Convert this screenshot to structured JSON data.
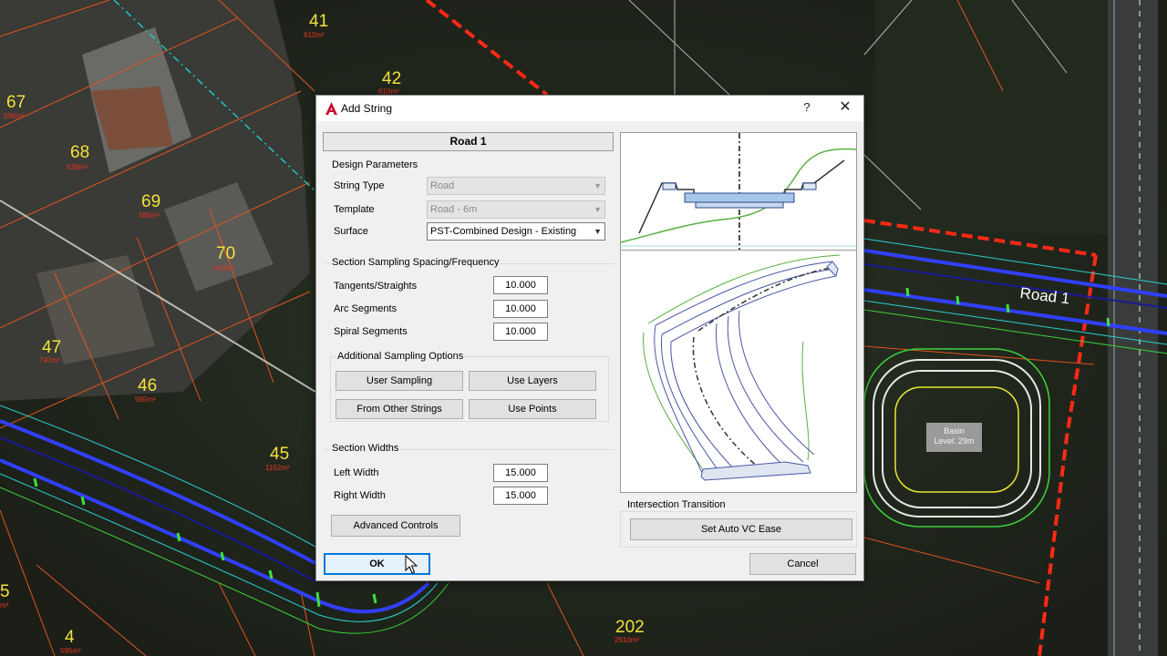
{
  "map": {
    "lots": [
      {
        "number": "41",
        "area": "610m²"
      },
      {
        "number": "42",
        "area": "610m²"
      },
      {
        "number": "67",
        "area": "596m²"
      },
      {
        "number": "68",
        "area": "638m²"
      },
      {
        "number": "69",
        "area": "585m²"
      },
      {
        "number": "70",
        "area": "643m²"
      },
      {
        "number": "47",
        "area": "740m²"
      },
      {
        "number": "46",
        "area": "565m²"
      },
      {
        "number": "45",
        "area": "1162m²"
      },
      {
        "number": "5",
        "area": "m²"
      },
      {
        "number": "4",
        "area": "595m²"
      },
      {
        "number": "202",
        "area": "2910m²"
      }
    ],
    "road_label": "Road 1",
    "basin_label_line1": "Basin",
    "basin_label_line2": "Level: 29m"
  },
  "dialog": {
    "title": "Add String",
    "help_glyph": "?",
    "close_glyph": "✕",
    "string_name": "Road 1",
    "design_parameters": {
      "heading": "Design Parameters",
      "string_type_label": "String Type",
      "string_type_value": "Road",
      "template_label": "Template",
      "template_value": "Road - 6m",
      "surface_label": "Surface",
      "surface_value": "PST-Combined Design - Existing"
    },
    "sampling": {
      "heading": "Section Sampling Spacing/Frequency",
      "tangents_label": "Tangents/Straights",
      "tangents_value": "10.000",
      "arc_label": "Arc Segments",
      "arc_value": "10.000",
      "spiral_label": "Spiral Segments",
      "spiral_value": "10.000",
      "additional_heading": "Additional Sampling Options",
      "user_sampling_btn": "User Sampling",
      "use_layers_btn": "Use Layers",
      "other_strings_btn": "From Other Strings",
      "use_points_btn": "Use Points"
    },
    "widths": {
      "heading": "Section Widths",
      "left_label": "Left Width",
      "left_value": "15.000",
      "right_label": "Right Width",
      "right_value": "15.000",
      "advanced_btn": "Advanced Controls"
    },
    "intersection": {
      "heading": "Intersection Transition",
      "vc_ease_btn": "Set Auto VC Ease"
    },
    "ok_btn": "OK",
    "cancel_btn": "Cancel"
  }
}
